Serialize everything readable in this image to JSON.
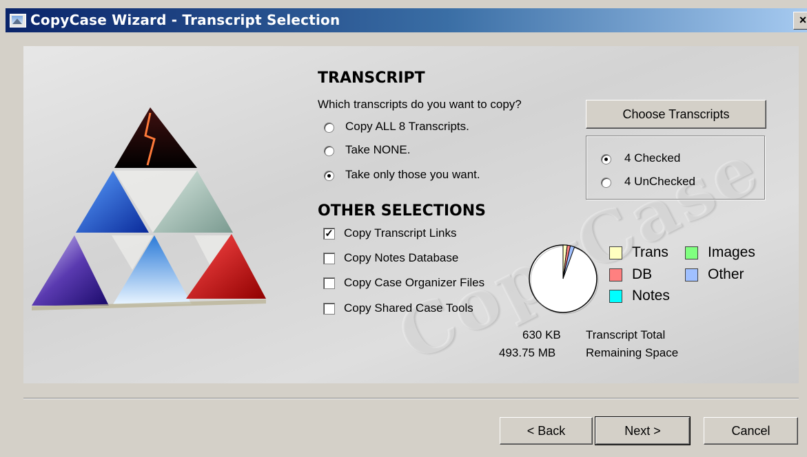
{
  "window": {
    "title": "CopyCase Wizard - Transcript Selection",
    "close_glyph": "×"
  },
  "watermark": "CopyCase",
  "transcript": {
    "heading": "TRANSCRIPT",
    "question": "Which transcripts do you want to copy?",
    "options": [
      {
        "label": "Copy ALL 8 Transcripts.",
        "selected": false
      },
      {
        "label": "Take NONE.",
        "selected": false
      },
      {
        "label": "Take only those you want.",
        "selected": true
      }
    ],
    "choose_button": "Choose Transcripts",
    "filter": [
      {
        "label": "4 Checked",
        "selected": true
      },
      {
        "label": "4 UnChecked",
        "selected": false
      }
    ]
  },
  "other": {
    "heading": "OTHER SELECTIONS",
    "items": [
      {
        "label": "Copy Transcript Links",
        "checked": true
      },
      {
        "label": "Copy Notes Database",
        "checked": false
      },
      {
        "label": "Copy Case Organizer Files",
        "checked": false
      },
      {
        "label": "Copy Shared Case Tools",
        "checked": false
      }
    ]
  },
  "usage": {
    "legend": [
      {
        "label": "Trans",
        "color": "#ffffc0"
      },
      {
        "label": "Images",
        "color": "#80ff80"
      },
      {
        "label": "DB",
        "color": "#ff8080"
      },
      {
        "label": "Other",
        "color": "#a0c0ff"
      },
      {
        "label": "Notes",
        "color": "#00ffff"
      }
    ],
    "transcript_total_value": "630 KB",
    "transcript_total_label": "Transcript Total",
    "remaining_value": "493.75 MB",
    "remaining_label": "Remaining Space",
    "pie_slices": [
      {
        "name": "Trans",
        "fraction": 0.02,
        "color": "#ffffc0"
      },
      {
        "name": "DB",
        "fraction": 0.015,
        "color": "#ff8080"
      },
      {
        "name": "Other",
        "fraction": 0.02,
        "color": "#a0c0ff"
      }
    ]
  },
  "footer": {
    "back": "< Back",
    "next": "Next >",
    "cancel": "Cancel"
  }
}
